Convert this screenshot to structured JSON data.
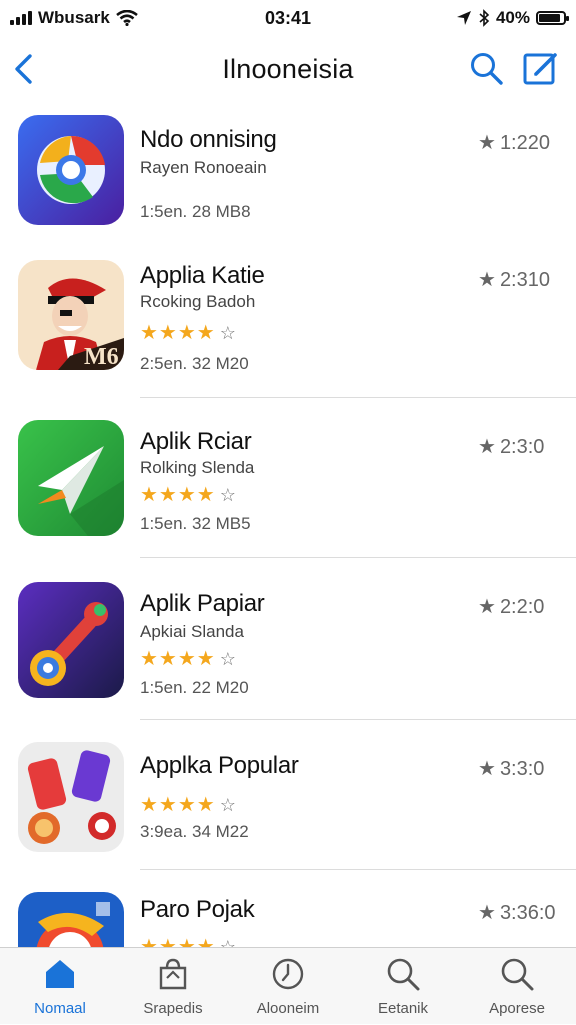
{
  "status": {
    "carrier": "Wbusark",
    "time": "03:41",
    "battery": "40%",
    "battery_level": 0.9
  },
  "nav": {
    "title": "Ilnooneisia"
  },
  "colors": {
    "accent": "#1a73d8",
    "star": "#f4a71d"
  },
  "apps": [
    {
      "name": "Ndo onnising",
      "subtitle": "Rayen Ronoeain",
      "stars": "",
      "star_outline": "",
      "meta": "1:5en. 28 MB8",
      "rating": "1:220"
    },
    {
      "name": "Applia Katie",
      "subtitle": "Rcoking Badoh",
      "stars": "★★★★",
      "star_outline": "☆",
      "meta": "2:5en. 32 M20",
      "rating": "2:310"
    },
    {
      "name": "Aplik Rciar",
      "subtitle": "Rolking Slenda",
      "stars": "★★★★",
      "star_outline": "☆",
      "meta": "1:5en. 32 MB5",
      "rating": "2:3:0"
    },
    {
      "name": "Aplik Papiar",
      "subtitle": "Apkiai Slanda",
      "stars": "★★★★",
      "star_outline": "☆",
      "meta": "1:5en. 22 M20",
      "rating": "2:2:0"
    },
    {
      "name": "Applka Popular",
      "subtitle": "",
      "stars": "★★★★",
      "star_outline": "☆",
      "meta": "3:9ea. 34 M22",
      "rating": "3:3:0"
    },
    {
      "name": "Paro Pojak",
      "subtitle": "",
      "stars": "★★★★",
      "star_outline": "☆",
      "meta": "",
      "rating": "3:36:0"
    }
  ],
  "tabs": [
    {
      "label": "Nomaal",
      "icon": "home-icon"
    },
    {
      "label": "Srapedis",
      "icon": "bag-icon"
    },
    {
      "label": "Alooneim",
      "icon": "clock-icon"
    },
    {
      "label": "Eetanik",
      "icon": "search-icon"
    },
    {
      "label": "Aporese",
      "icon": "search-icon"
    }
  ]
}
